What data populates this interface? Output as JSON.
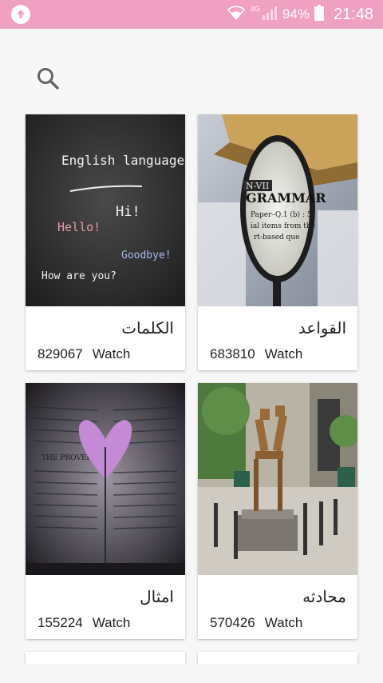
{
  "status_bar": {
    "network": "3G",
    "battery": "94%",
    "time": "21:48",
    "color": "#f0a0c0"
  },
  "search": {
    "icon": "search-icon"
  },
  "cards": [
    {
      "title": "القواعد",
      "count": "683810",
      "watch_label": "Watch",
      "image": "magnifier-grammar-book"
    },
    {
      "title": "الكلمات",
      "count": "829067",
      "watch_label": "Watch",
      "image": "chalkboard-english-language",
      "chalk": {
        "heading": "English language",
        "hello": "Hello!",
        "hi": "Hi!",
        "how": "How are you?",
        "goodbye": "Goodbye!"
      }
    },
    {
      "title": "محادثه",
      "count": "570426",
      "watch_label": "Watch",
      "image": "statues-conversation"
    },
    {
      "title": "امثال",
      "count": "155224",
      "watch_label": "Watch",
      "image": "open-book-heart-proverbs",
      "book_text": "THE PROVERBS"
    }
  ]
}
